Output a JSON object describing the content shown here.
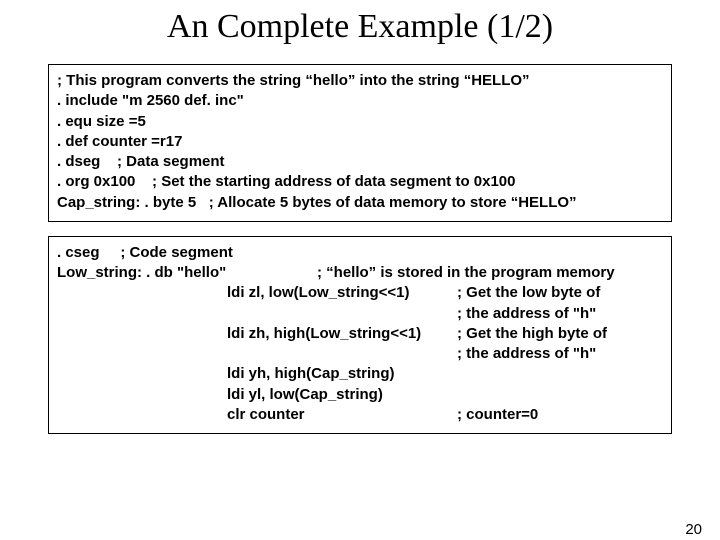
{
  "title": "An Complete Example (1/2)",
  "page_number": "20",
  "box1": {
    "l1": "; This program converts the string “hello” into the string “HELLO”",
    "l2": ". include \"m 2560 def. inc\"",
    "l3": ". equ size =5",
    "l4": ". def counter =r17",
    "l5": ". dseg    ; Data segment",
    "l6": ". org 0x100    ; Set the starting address of data segment to 0x100",
    "l7": "Cap_string: . byte 5   ; Allocate 5 bytes of data memory to store “HELLO”"
  },
  "box2": {
    "l1": ". cseg     ; Code segment",
    "l2_a": "Low_string: . db \"hello\"",
    "l2_b": "; “hello” is stored in the program memory",
    "r1_instr": "ldi zl, low(Low_string<<1)",
    "r1_cmt": "; Get the low byte of",
    "r2_cmt": "; the address of \"h\"",
    "r3_instr": "ldi zh, high(Low_string<<1)",
    "r3_cmt": "; Get the high byte of",
    "r4_cmt": "; the address of \"h\"",
    "r5_instr": "ldi yh, high(Cap_string)",
    "r6_instr": "ldi yl, low(Cap_string)",
    "r7_instr": "clr counter",
    "r7_cmt": "; counter=0"
  }
}
